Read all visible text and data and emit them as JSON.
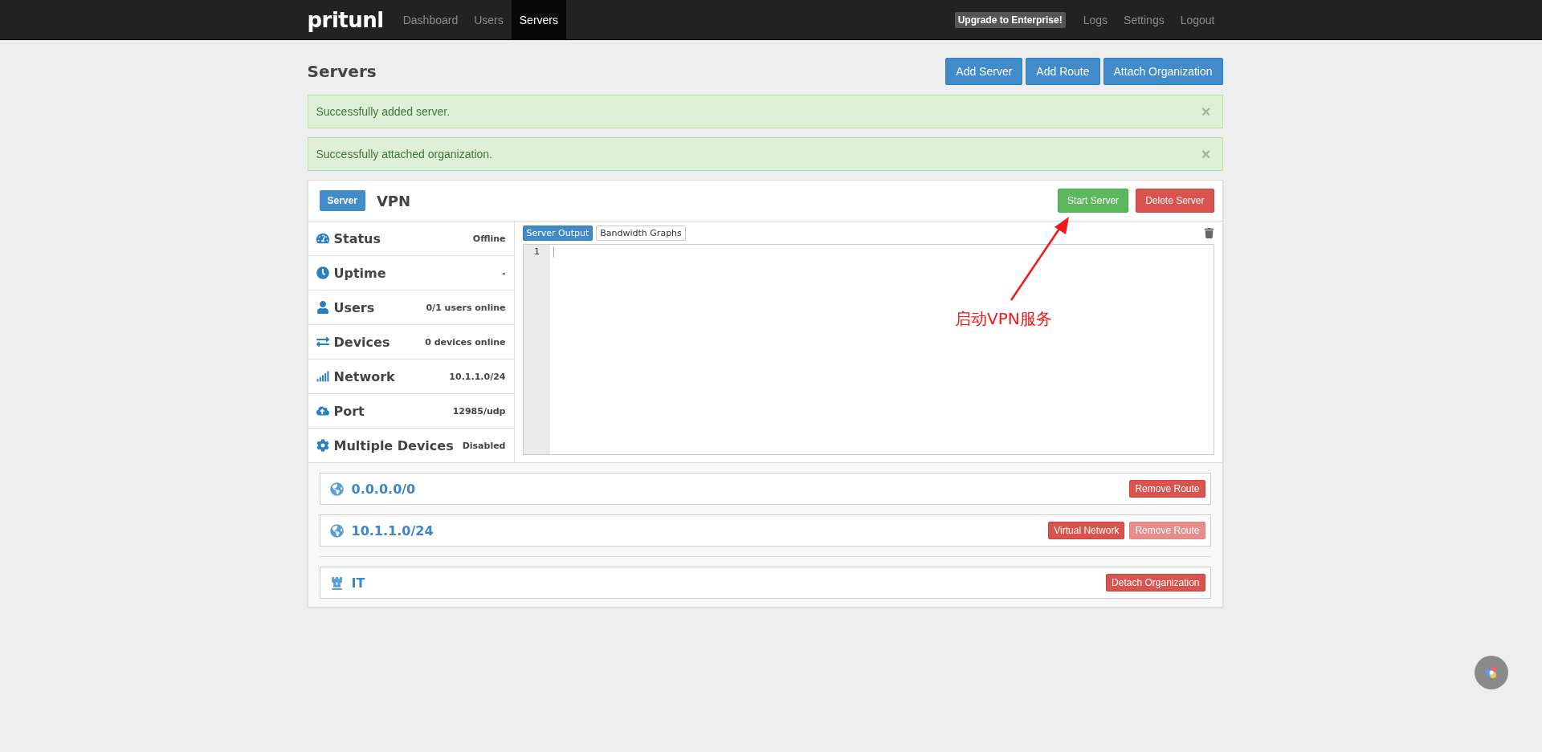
{
  "navbar": {
    "brand": "pritunl",
    "links": [
      {
        "label": "Dashboard",
        "selected": false
      },
      {
        "label": "Users",
        "selected": false
      },
      {
        "label": "Servers",
        "selected": true
      }
    ],
    "upgrade": "Upgrade to Enterprise!",
    "right_links": [
      "Logs",
      "Settings",
      "Logout"
    ]
  },
  "page": {
    "title": "Servers",
    "buttons": [
      "Add Server",
      "Add Route",
      "Attach Organization"
    ]
  },
  "alerts": [
    {
      "text": "Successfully added server.",
      "close": "×"
    },
    {
      "text": "Successfully attached organization.",
      "close": "×"
    }
  ],
  "server": {
    "badge": "Server",
    "name": "VPN",
    "actions": [
      {
        "label": "Start Server",
        "kind": "success"
      },
      {
        "label": "Delete Server",
        "kind": "danger"
      }
    ],
    "stats": [
      {
        "kind": "gauge",
        "label": "Status",
        "value": "Offline"
      },
      {
        "kind": "clock",
        "label": "Uptime",
        "value": "-"
      },
      {
        "kind": "user",
        "label": "Users",
        "value": "0/1 users online"
      },
      {
        "kind": "swap",
        "label": "Devices",
        "value": "0 devices online"
      },
      {
        "kind": "signal",
        "label": "Network",
        "value": "10.1.1.0/24"
      },
      {
        "kind": "cloud",
        "label": "Port",
        "value": "12985/udp"
      },
      {
        "kind": "gear",
        "label": "Multiple Devices",
        "value": "Disabled"
      }
    ],
    "output_tabs": [
      {
        "label": "Server Output",
        "selected": true
      },
      {
        "label": "Bandwidth Graphs",
        "selected": false
      }
    ],
    "line_numbers": [
      "1"
    ],
    "routes": [
      {
        "network": "0.0.0.0/0",
        "buttons": [
          {
            "label": "Remove Route",
            "disabled": false
          }
        ]
      },
      {
        "network": "10.1.1.0/24",
        "buttons": [
          {
            "label": "Virtual Network",
            "disabled": false
          },
          {
            "label": "Remove Route",
            "disabled": true
          }
        ]
      }
    ],
    "organizations": [
      {
        "name": "IT",
        "button": "Detach Organization"
      }
    ]
  },
  "annotation": {
    "text": "启动VPN服务"
  }
}
